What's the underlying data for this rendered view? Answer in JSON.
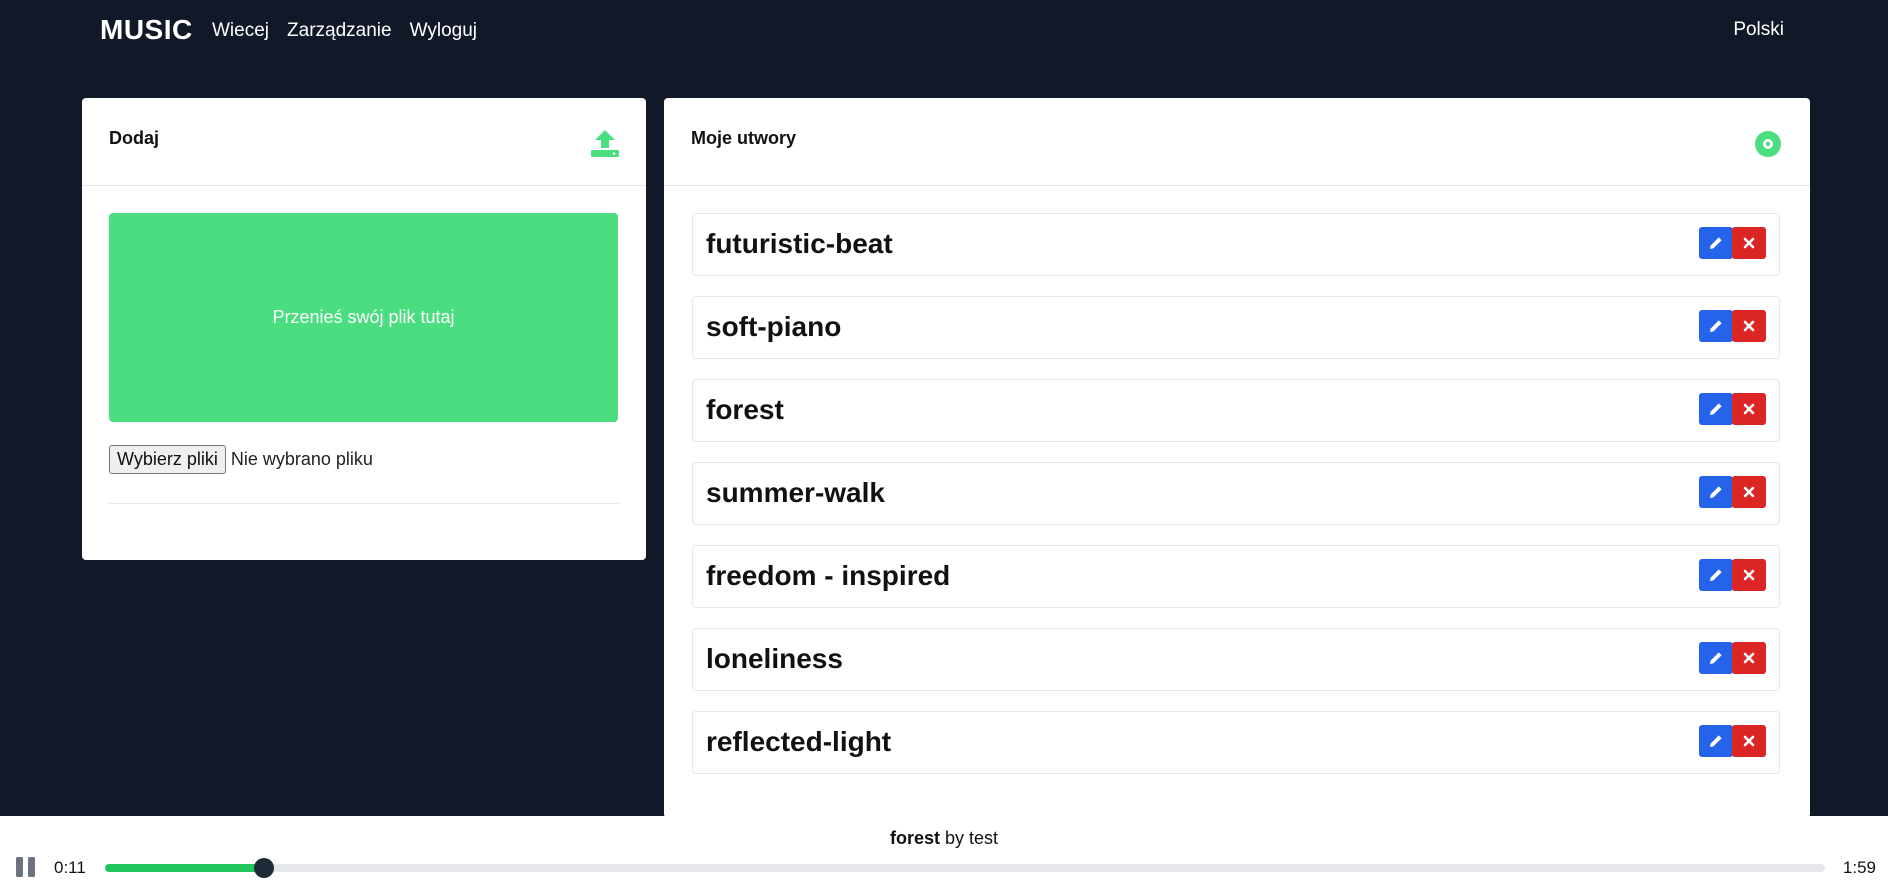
{
  "nav": {
    "brand": "MUSIC",
    "links": [
      "Wiecej",
      "Zarządzanie",
      "Wyloguj"
    ],
    "language": "Polski"
  },
  "add_card": {
    "title": "Dodaj",
    "icon": "upload-icon",
    "dropzone_text": "Przenieś swój plik tutaj",
    "file_button": "Wybierz pliki",
    "file_status": "Nie wybrano pliku"
  },
  "songs_card": {
    "title": "Moje utwory",
    "icon": "disc-icon",
    "songs": [
      {
        "title": "futuristic-beat"
      },
      {
        "title": "soft-piano"
      },
      {
        "title": "forest"
      },
      {
        "title": "summer-walk"
      },
      {
        "title": "freedom - inspired"
      },
      {
        "title": "loneliness"
      },
      {
        "title": "reflected-light"
      }
    ]
  },
  "player": {
    "track_title": "forest",
    "by_text": "by",
    "artist": "test",
    "current_time": "0:11",
    "duration": "1:59",
    "progress_fraction": 0.0925
  },
  "colors": {
    "background": "#111827",
    "accent_green": "#4ade80",
    "edit_blue": "#2563eb",
    "delete_red": "#dc2626"
  }
}
